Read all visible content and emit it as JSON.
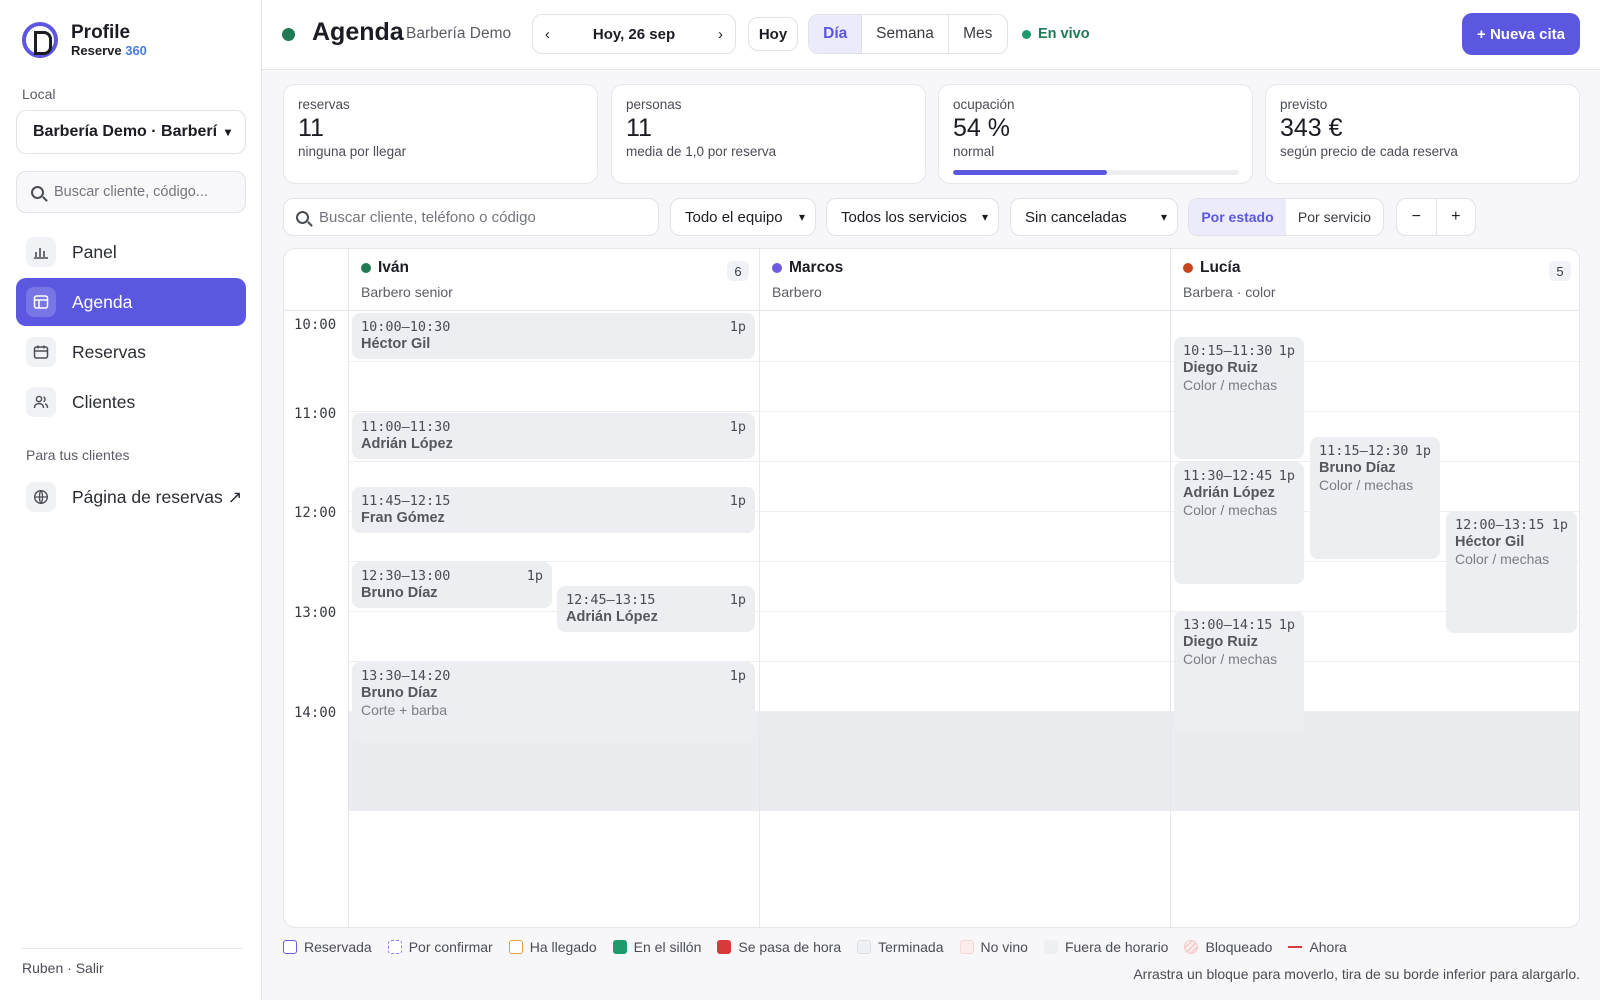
{
  "brand": {
    "title": "Profile",
    "sub_prefix": "Reserve ",
    "sub_number": "360"
  },
  "sidebar": {
    "local_label": "Local",
    "local_value": "Barbería Demo · Barberí",
    "search_placeholder": "Buscar cliente, código...",
    "items": [
      {
        "label": "Panel",
        "icon": "bar-chart-icon"
      },
      {
        "label": "Agenda",
        "icon": "calendar-grid-icon",
        "active": true
      },
      {
        "label": "Reservas",
        "icon": "calendar-icon"
      },
      {
        "label": "Clientes",
        "icon": "users-icon"
      }
    ],
    "section_label": "Para tus clientes",
    "booking_page_label": "Página de reservas ↗",
    "footer": "Ruben · Salir"
  },
  "header": {
    "title": "Agenda",
    "subtitle": "Barbería Demo",
    "date_label": "Hoy, 26 sep",
    "prev": "‹",
    "next": "›",
    "today_button": "Hoy",
    "views": [
      "Día",
      "Semana",
      "Mes"
    ],
    "active_view": "Día",
    "live_label": "En vivo",
    "new_button": "+ Nueva cita"
  },
  "stats": [
    {
      "label": "reservas",
      "value": "11",
      "sub": "ninguna por llegar"
    },
    {
      "label": "personas",
      "value": "11",
      "sub": "media de 1,0 por reserva"
    },
    {
      "label": "ocupación",
      "value": "54 %",
      "sub": "normal",
      "progress": 0.54
    },
    {
      "label": "previsto",
      "value": "343 €",
      "sub": "según precio de cada reserva"
    }
  ],
  "filters": {
    "search_placeholder": "Buscar cliente, teléfono o código",
    "team": "Todo el equipo",
    "services": "Todos los servicios",
    "status": "Sin canceladas",
    "group_by": [
      "Por estado",
      "Por servicio"
    ],
    "group_active": "Por estado",
    "zoom_out": "−",
    "zoom_in": "+"
  },
  "calendar": {
    "times": [
      "10:00",
      "11:00",
      "12:00",
      "13:00",
      "14:00"
    ],
    "staff": [
      {
        "name": "Iván",
        "role": "Barbero senior",
        "count": "6",
        "color": "#1f7a55"
      },
      {
        "name": "Marcos",
        "role": "Barbero",
        "count": "",
        "color": "#6a5be0"
      },
      {
        "name": "Lucía",
        "role": "Barbera · color",
        "count": "5",
        "color": "#c8461e"
      }
    ],
    "events": [
      {
        "time": "10:00–10:30",
        "pax": "1p",
        "name": "Héctor Gil",
        "service": ""
      },
      {
        "time": "11:00–11:30",
        "pax": "1p",
        "name": "Adrián López",
        "service": ""
      },
      {
        "time": "11:45–12:15",
        "pax": "1p",
        "name": "Fran Gómez",
        "service": ""
      },
      {
        "time": "12:30–13:00",
        "pax": "1p",
        "name": "Bruno Díaz",
        "service": ""
      },
      {
        "time": "12:45–13:15",
        "pax": "1p",
        "name": "Adrián López",
        "service": ""
      },
      {
        "time": "13:30–14:20",
        "pax": "1p",
        "name": "Bruno Díaz",
        "service": "Corte + barba"
      },
      {
        "time": "10:15–11:30",
        "pax": "1p",
        "name": "Diego Ruiz",
        "service": "Color / mechas"
      },
      {
        "time": "11:30–12:45",
        "pax": "1p",
        "name": "Adrián López",
        "service": "Color / mechas"
      },
      {
        "time": "11:15–12:30",
        "pax": "1p",
        "name": "Bruno Díaz",
        "service": "Color / mechas"
      },
      {
        "time": "12:00–13:15",
        "pax": "1p",
        "name": "Héctor Gil",
        "service": "Color / mechas"
      },
      {
        "time": "13:00–14:15",
        "pax": "1p",
        "name": "Diego Ruiz",
        "service": "Color / mechas"
      }
    ]
  },
  "legend": [
    {
      "label": "Reservada",
      "fill": "#ffffff",
      "border": "#6a5be0"
    },
    {
      "label": "Por confirmar",
      "fill": "#ffffff",
      "border": "#8a86e8"
    },
    {
      "label": "Ha llegado",
      "fill": "#ffffff",
      "border": "#d9a43a"
    },
    {
      "label": "En el sillón",
      "fill": "#1f9a6a",
      "border": "#1f9a6a"
    },
    {
      "label": "Se pasa de hora",
      "fill": "#d63a3a",
      "border": "#d63a3a"
    },
    {
      "label": "Terminada",
      "fill": "#eef0f4",
      "border": "#dcdee5"
    },
    {
      "label": "No vino",
      "fill": "#fdecec",
      "border": "#f7d6d6"
    },
    {
      "label": "Fuera de horario",
      "fill": "#eeeff2",
      "border": "#eeeff2"
    },
    {
      "label": "Bloqueado",
      "fill": "#fbe6e6",
      "border": "#f2c9c9"
    },
    {
      "label": "Ahora",
      "fill": "#d63a3a",
      "border": "#d63a3a"
    }
  ],
  "hint": "Arrastra un bloque para moverlo, tira de su borde inferior para alargarlo."
}
